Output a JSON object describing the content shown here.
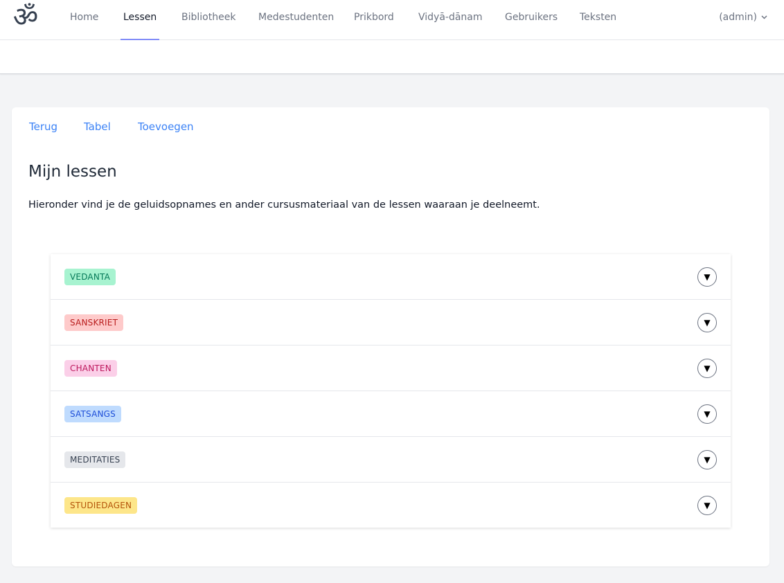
{
  "header": {
    "logo_glyph": "ॐ",
    "nav": [
      {
        "label": "Home",
        "active": false
      },
      {
        "label": "Lessen",
        "active": true
      },
      {
        "label": "Bibliotheek",
        "active": false
      },
      {
        "label": "Medestudenten",
        "active": false
      },
      {
        "label": "Prikbord",
        "active": false
      },
      {
        "label": "Vidyā-dānam",
        "active": false
      },
      {
        "label": "Gebruikers",
        "active": false
      },
      {
        "label": "Teksten",
        "active": false
      }
    ],
    "user": {
      "label": "(admin)",
      "icon": "chevron-down-icon"
    },
    "accent_color": "#818cf8"
  },
  "subnav": {
    "back": "Terug",
    "table": "Tabel",
    "add": "Toevoegen",
    "link_color": "#3b82f6"
  },
  "main": {
    "title": "Mijn lessen",
    "intro": "Hieronder vind je de geluidsopnames en ander cursusmateriaal van de lessen waaraan je deelneemt."
  },
  "categories": [
    {
      "label": "VEDANTA",
      "bg": "#a7f3d0",
      "fg": "#047857"
    },
    {
      "label": "SANSKRIET",
      "bg": "#fecaca",
      "fg": "#b91c1c"
    },
    {
      "label": "CHANTEN",
      "bg": "#fbcfe8",
      "fg": "#be185d"
    },
    {
      "label": "SATSANGS",
      "bg": "#bfdbfe",
      "fg": "#1d4ed8"
    },
    {
      "label": "MEDITATIES",
      "bg": "#e5e7eb",
      "fg": "#374151"
    },
    {
      "label": "STUDIEDAGEN",
      "bg": "#fde68a",
      "fg": "#b45309"
    }
  ],
  "toggle_glyph": "▼"
}
